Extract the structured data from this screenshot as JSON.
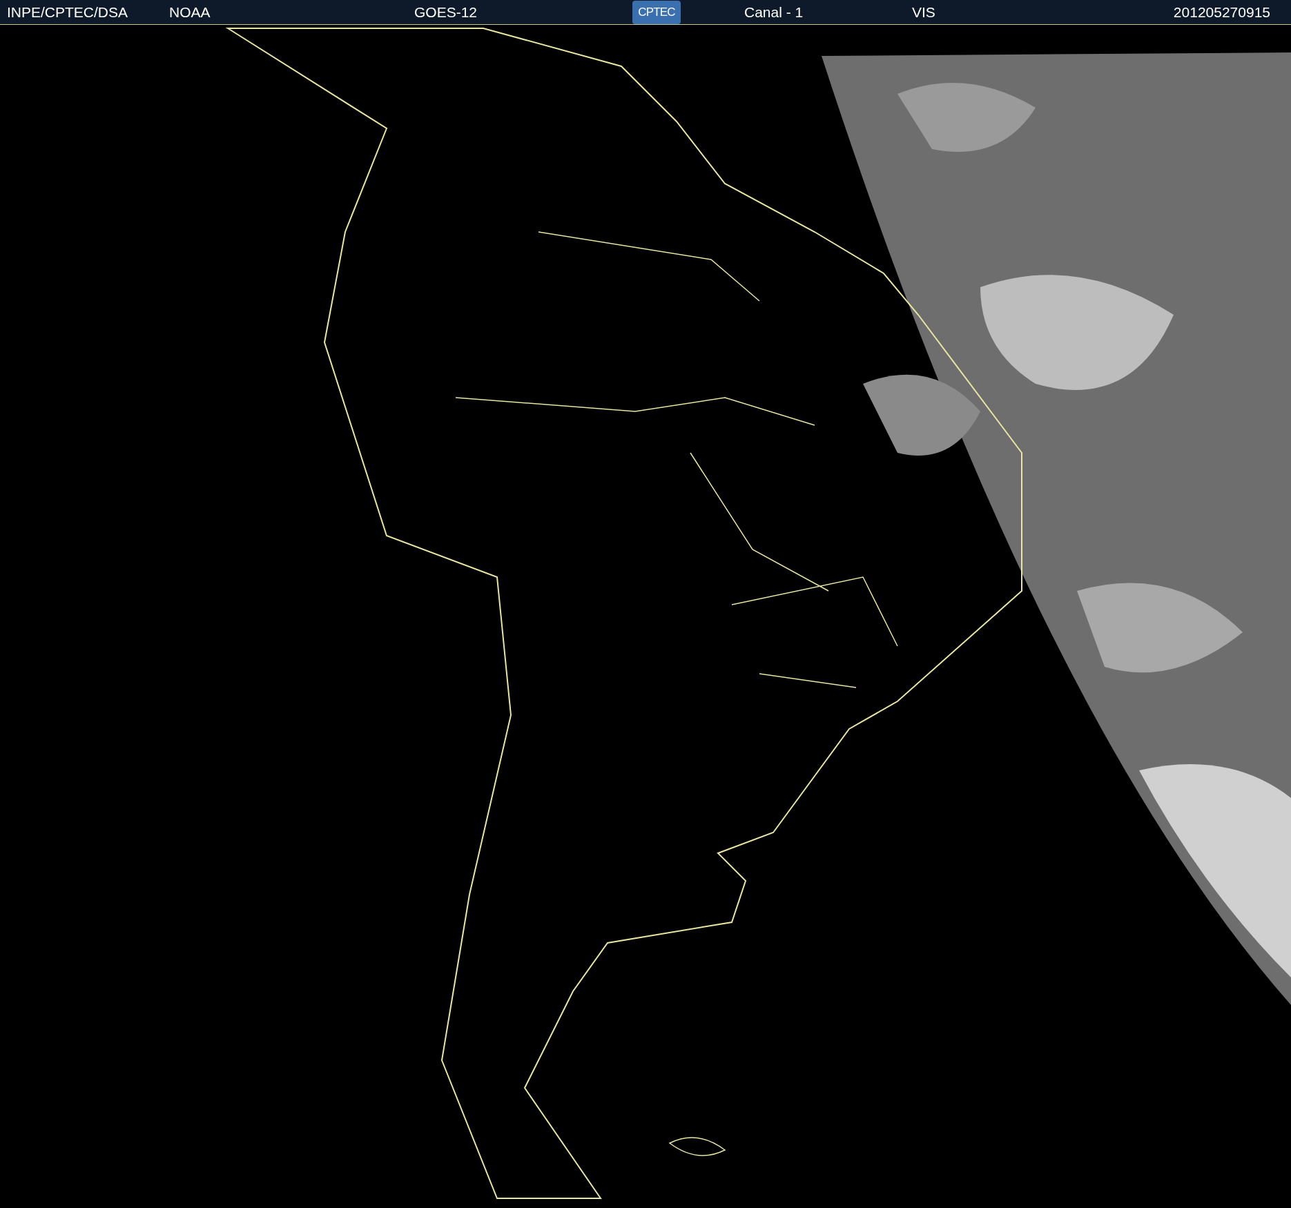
{
  "header": {
    "source": "INPE/CPTEC/DSA",
    "agency": "NOAA",
    "satellite": "GOES-12",
    "logo": "CPTEC",
    "channel": "Canal - 1",
    "band": "VIS",
    "timestamp": "201205270915"
  }
}
